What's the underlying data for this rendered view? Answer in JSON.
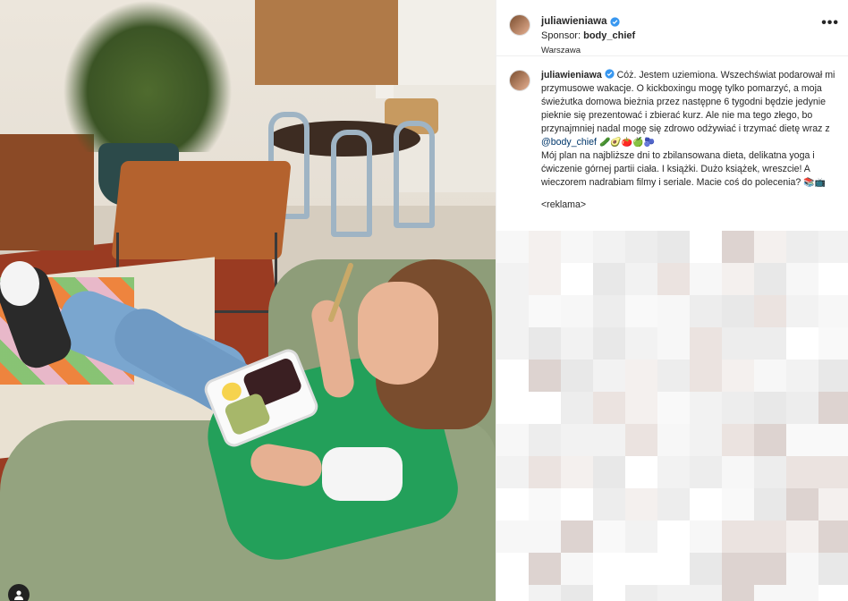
{
  "post": {
    "username": "juliawieniawa",
    "sponsor_prefix": "Sponsor: ",
    "sponsor_brand": "body_chief",
    "location": "Warszawa",
    "more": "•••"
  },
  "caption": {
    "username": "juliawieniawa",
    "text_before_mention": "Cóż. Jestem uziemiona. Wszechświat podarował mi przymusowe wakacje. O kickboxingu mogę tylko pomarzyć, a moja świeżutka domowa bieżnia przez następne 6 tygodni będzie jedynie pieknie się prezentować i zbierać kurz. Ale nie ma tego złego, bo przynajmniej nadal mogę się zdrowo odżywiać i trzymać dietę wraz z ",
    "mention": "@body_chief",
    "emojis_1": "🥒🥑🍅🍏🫐",
    "text_after": "Mój plan na najbliższe dni to zbilansowana dieta, delikatna yoga i ćwiczenie górnej partii ciała. I książki. Dużo książek, wreszcie! A wieczorem nadrabiam filmy i seriale. Macie coś do polecenia? ",
    "emojis_2": "📚📺",
    "reklama": "<reklama>"
  },
  "icons": {
    "verified": "verified-badge-icon",
    "tagged_user": "user-tag-icon"
  },
  "colors": {
    "verified_blue": "#3897f0",
    "mention": "#00376b",
    "text": "#262626",
    "divider": "#efefef"
  }
}
